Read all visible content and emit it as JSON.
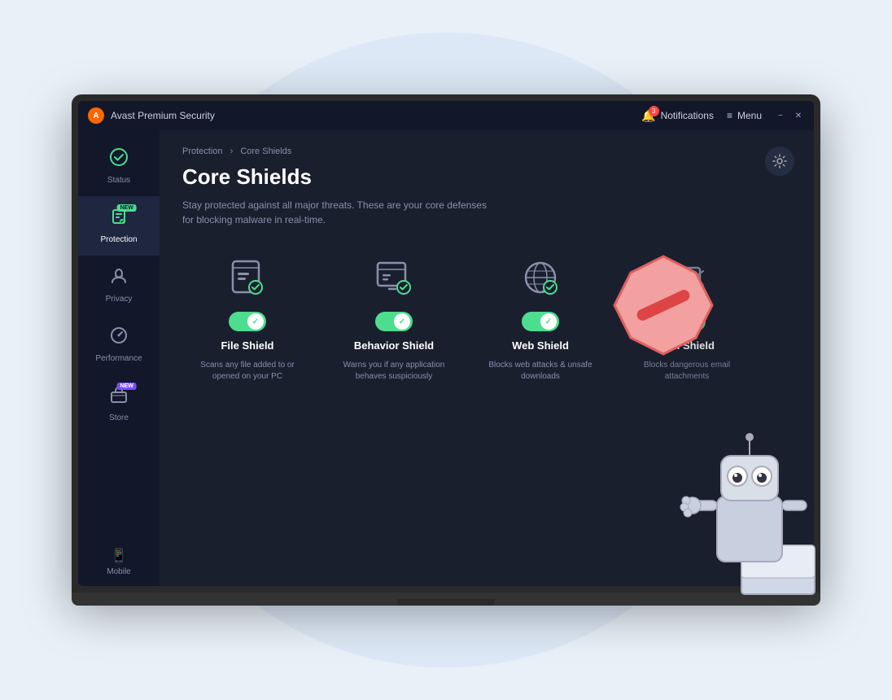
{
  "app": {
    "title": "Avast Premium Security",
    "logo": "A"
  },
  "titlebar": {
    "notifications_label": "Notifications",
    "notifications_count": "3",
    "menu_label": "Menu",
    "minimize": "−",
    "close": "✕"
  },
  "sidebar": {
    "items": [
      {
        "id": "status",
        "label": "Status",
        "icon": "check-circle",
        "active": false,
        "new": false
      },
      {
        "id": "protection",
        "label": "Protection",
        "icon": "lock",
        "active": true,
        "new": true,
        "new_type": "green"
      },
      {
        "id": "privacy",
        "label": "Privacy",
        "icon": "fingerprint",
        "active": false,
        "new": false
      },
      {
        "id": "performance",
        "label": "Performance",
        "icon": "gauge",
        "active": false,
        "new": false
      },
      {
        "id": "store",
        "label": "Store",
        "icon": "cart",
        "active": false,
        "new": true,
        "new_type": "purple"
      }
    ],
    "mobile_label": "Mobile"
  },
  "breadcrumb": {
    "parent": "Protection",
    "separator": "›",
    "current": "Core Shields"
  },
  "page": {
    "title": "Core Shields",
    "description": "Stay protected against all major threats. These are your core defenses for blocking malware in real-time."
  },
  "shields": [
    {
      "id": "file",
      "name": "File Shield",
      "description": "Scans any file added to or opened on your PC",
      "enabled": true
    },
    {
      "id": "behavior",
      "name": "Behavior Shield",
      "description": "Warns you if any application behaves suspiciously",
      "enabled": true
    },
    {
      "id": "web",
      "name": "Web Shield",
      "description": "Blocks web attacks & unsafe downloads",
      "enabled": true
    },
    {
      "id": "mail",
      "name": "Mail Shield",
      "description": "Blocks dangerous email attachments",
      "enabled": true
    }
  ],
  "colors": {
    "active_green": "#4cdd8e",
    "bg_dark": "#1a1f2e",
    "bg_darker": "#12172a",
    "text_muted": "#8890aa",
    "accent_purple": "#7c4dff"
  }
}
